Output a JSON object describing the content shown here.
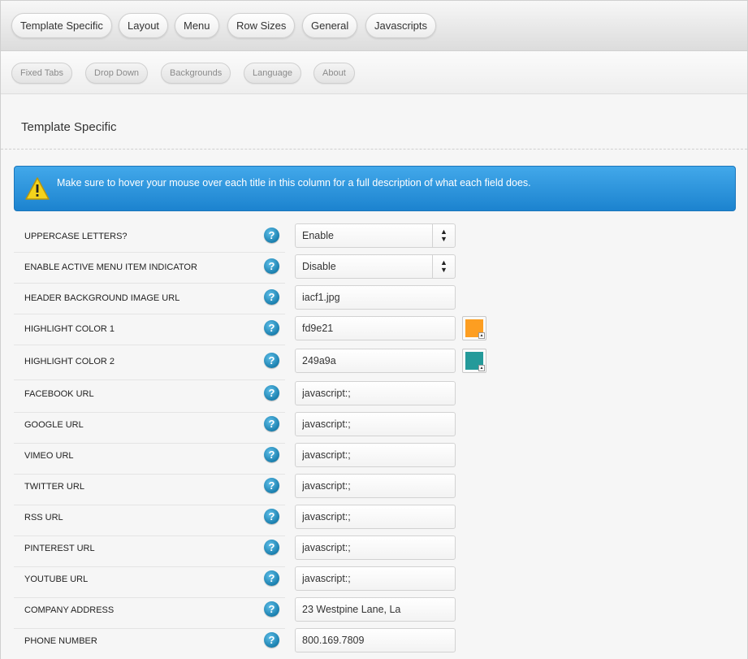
{
  "top_tabs": [
    "Template Specific",
    "Layout",
    "Menu",
    "Row Sizes",
    "General",
    "Javascripts"
  ],
  "sub_tabs": [
    "Fixed Tabs",
    "Drop Down",
    "Backgrounds",
    "Language",
    "About"
  ],
  "section_title": "Template Specific",
  "notice": "Make sure to hover your mouse over each title in this column for a full description of what each field does.",
  "help_glyph": "?",
  "fields": [
    {
      "label": "UPPERCASE LETTERS?",
      "type": "select",
      "value": "Enable"
    },
    {
      "label": "ENABLE ACTIVE MENU ITEM INDICATOR",
      "type": "select",
      "value": "Disable"
    },
    {
      "label": "HEADER BACKGROUND IMAGE URL",
      "type": "text",
      "value": "iacf1.jpg"
    },
    {
      "label": "HIGHLIGHT COLOR 1",
      "type": "color",
      "value": "fd9e21",
      "color": "#fd9e21"
    },
    {
      "label": "HIGHLIGHT COLOR 2",
      "type": "color",
      "value": "249a9a",
      "color": "#249a9a"
    },
    {
      "label": "FACEBOOK URL",
      "type": "text",
      "value": "javascript:;"
    },
    {
      "label": "GOOGLE URL",
      "type": "text",
      "value": "javascript:;"
    },
    {
      "label": "VIMEO URL",
      "type": "text",
      "value": "javascript:;"
    },
    {
      "label": "TWITTER URL",
      "type": "text",
      "value": "javascript:;"
    },
    {
      "label": "RSS URL",
      "type": "text",
      "value": "javascript:;"
    },
    {
      "label": "PINTEREST URL",
      "type": "text",
      "value": "javascript:;"
    },
    {
      "label": "YOUTUBE URL",
      "type": "text",
      "value": "javascript:;"
    },
    {
      "label": "COMPANY ADDRESS",
      "type": "text",
      "value": "23 Westpine Lane, La"
    },
    {
      "label": "PHONE NUMBER",
      "type": "text",
      "value": "800.169.7809"
    }
  ]
}
